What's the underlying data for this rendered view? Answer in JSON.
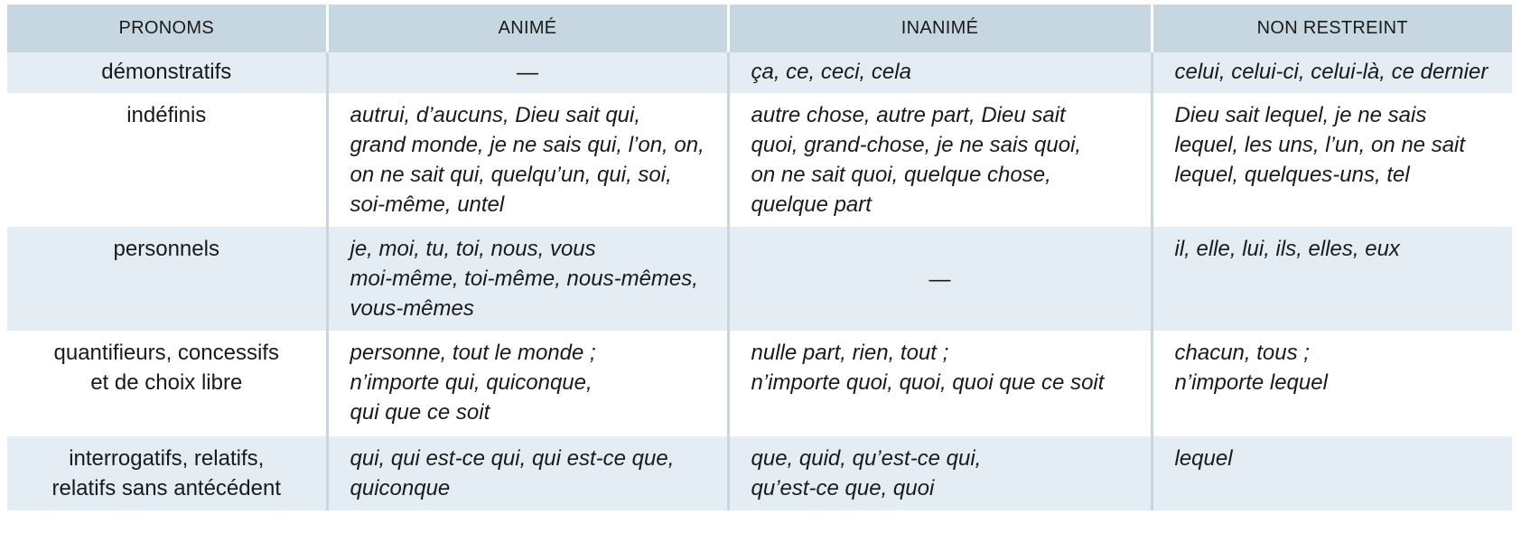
{
  "table": {
    "headers": [
      "PRONOMS",
      "ANIMÉ",
      "INANIMÉ",
      "NON RESTREINT"
    ],
    "rows": [
      {
        "category": [
          "démonstratifs"
        ],
        "anime": [
          "—"
        ],
        "inanime": [
          "ça, ce, ceci, cela"
        ],
        "non_restreint": [
          "celui, celui-ci, celui-là, ce dernier"
        ]
      },
      {
        "category": [
          "indéfinis"
        ],
        "anime": [
          "autrui, d’aucuns, Dieu sait qui,",
          "grand monde, je ne sais qui, l’on, on,",
          "on ne sait qui, quelqu’un, qui, soi,",
          "soi-même, untel"
        ],
        "inanime": [
          "autre chose, autre part, Dieu sait",
          "quoi, grand-chose, je ne sais quoi,",
          "on ne sait quoi, quelque chose,",
          "quelque part"
        ],
        "non_restreint": [
          "Dieu sait lequel, je ne sais",
          "lequel, les uns, l’un, on ne sait",
          "lequel, quelques-uns, tel"
        ]
      },
      {
        "category": [
          "personnels"
        ],
        "anime": [
          "je, moi, tu, toi, nous, vous",
          "moi-même, toi-même, nous-mêmes,",
          "vous-mêmes"
        ],
        "inanime": [
          "—"
        ],
        "non_restreint": [
          "il, elle, lui, ils, elles, eux"
        ]
      },
      {
        "category": [
          "quantifieurs, concessifs",
          "et de choix libre"
        ],
        "anime": [
          "personne, tout le monde ;",
          "n’importe qui, quiconque,",
          "qui que ce soit"
        ],
        "inanime": [
          "nulle part, rien, tout ;",
          "n’importe quoi, quoi, quoi que ce soit"
        ],
        "non_restreint": [
          "chacun, tous ;",
          "n’importe lequel"
        ]
      },
      {
        "category": [
          "interrogatifs, relatifs,",
          "relatifs sans antécédent"
        ],
        "anime": [
          "qui, qui est-ce qui, qui est-ce que,",
          "quiconque"
        ],
        "inanime": [
          "que, quid, qu’est-ce qui,",
          "qu’est-ce que, quoi"
        ],
        "non_restreint": [
          "lequel"
        ]
      }
    ]
  }
}
